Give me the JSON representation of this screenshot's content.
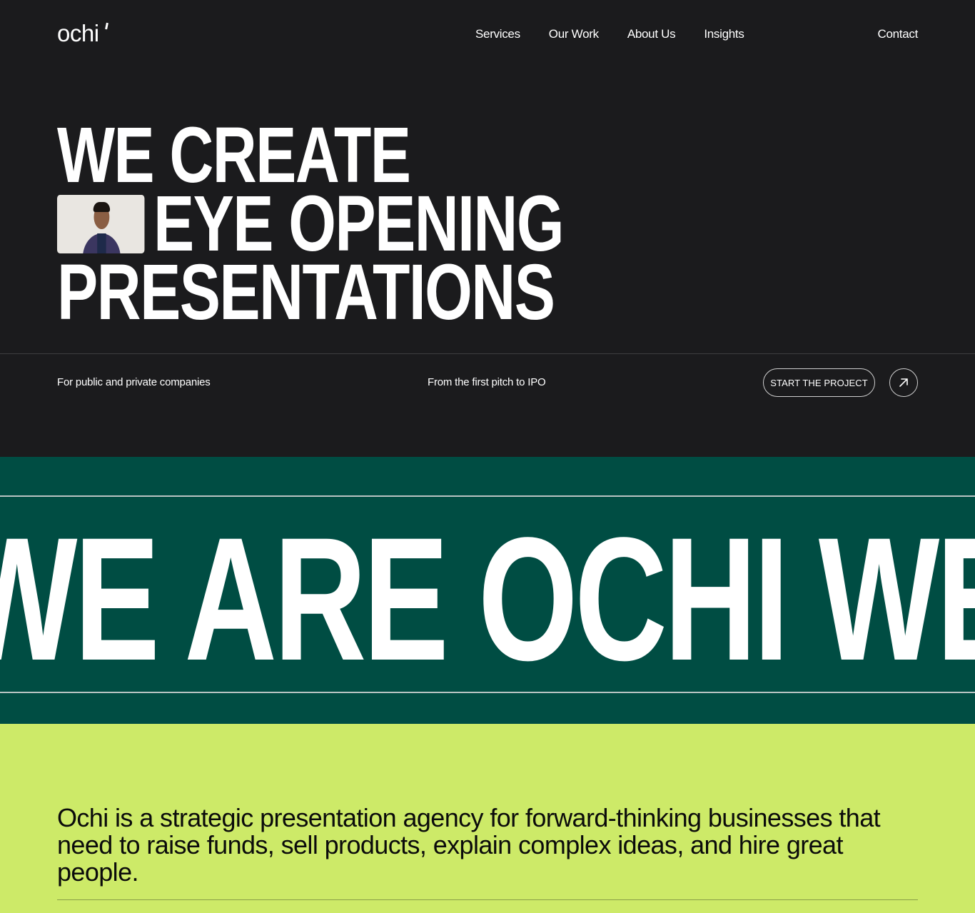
{
  "brand": {
    "logo_text": "ochi"
  },
  "nav": {
    "links": [
      "Services",
      "Our Work",
      "About Us",
      "Insights"
    ],
    "contact": "Contact"
  },
  "hero": {
    "headline": [
      "WE CREATE",
      "EYE OPENING",
      "PRESENTATIONS"
    ],
    "meta_left": "For public and private companies",
    "meta_center": "From the first pitch to IPO",
    "cta_label": "START THE PROJECT",
    "cta_icon": "arrow-up-right-icon"
  },
  "marquee": {
    "text": "WE ARE OCHI WE ARE"
  },
  "about": {
    "text": "Ochi is a strategic presentation agency for forward-thinking businesses that need to raise funds, sell products, explain complex ideas, and hire great people."
  },
  "colors": {
    "dark_bg": "#1b1b1d",
    "marquee_bg": "#004d43",
    "lime_bg": "#cdea68",
    "text_light": "#ffffff",
    "text_dark": "#0b0b0b"
  }
}
